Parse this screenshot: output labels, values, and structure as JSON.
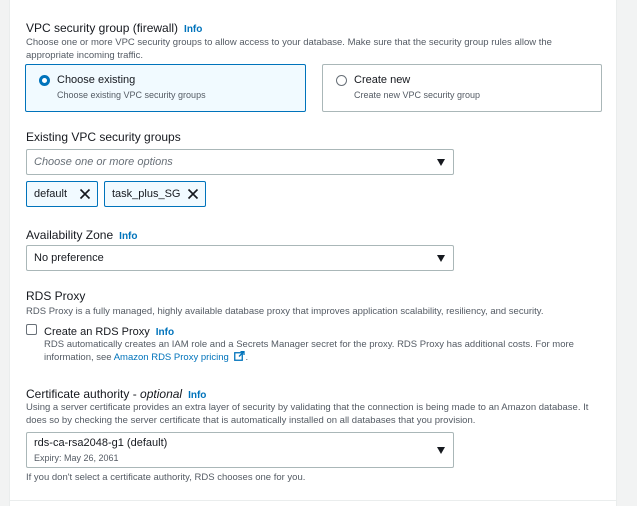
{
  "security_group": {
    "title": "VPC security group (firewall)",
    "info": "Info",
    "description": "Choose one or more VPC security groups to allow access to your database. Make sure that the security group rules allow the appropriate incoming traffic.",
    "options": [
      {
        "title": "Choose existing",
        "subtitle": "Choose existing VPC security groups",
        "selected": true
      },
      {
        "title": "Create new",
        "subtitle": "Create new VPC security group",
        "selected": false
      }
    ]
  },
  "existing_groups": {
    "label": "Existing VPC security groups",
    "placeholder": "Choose one or more options",
    "tokens": [
      "default",
      "task_plus_SG"
    ]
  },
  "availability_zone": {
    "label": "Availability Zone",
    "info": "Info",
    "value": "No preference"
  },
  "rds_proxy": {
    "title": "RDS Proxy",
    "description": "RDS Proxy is a fully managed, highly available database proxy that improves application scalability, resiliency, and security.",
    "checkbox_label": "Create an RDS Proxy",
    "info": "Info",
    "checked": false,
    "detail_text": "RDS automatically creates an IAM role and a Secrets Manager secret for the proxy. RDS Proxy has additional costs. For more information, see ",
    "link_text": "Amazon RDS Proxy pricing",
    "detail_end": "."
  },
  "certificate": {
    "label": "Certificate authority - ",
    "label_optional": "optional",
    "info": "Info",
    "description": "Using a server certificate provides an extra layer of security by validating that the connection is being made to an Amazon database. It does so by checking the server certificate that is automatically installed on all databases that you provision.",
    "value": "rds-ca-rsa2048-g1 (default)",
    "expiry": "Expiry: May 26, 2061",
    "hint": "If you don't select a certificate authority, RDS chooses one for you."
  },
  "colors": {
    "accent": "#0073bb",
    "text": "#16191f",
    "muted": "#545b64",
    "border": "#aab7b8"
  }
}
